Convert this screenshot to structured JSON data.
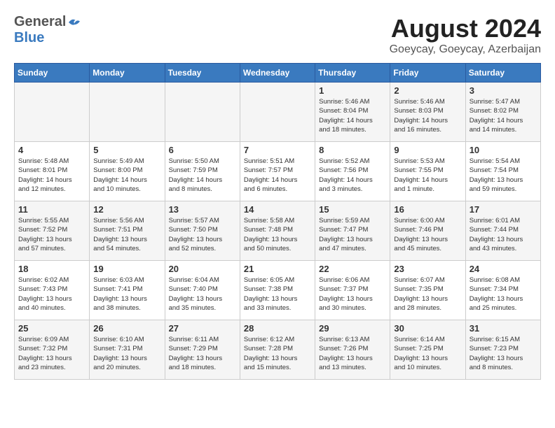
{
  "header": {
    "logo_general": "General",
    "logo_blue": "Blue",
    "month_title": "August 2024",
    "location": "Goeycay, Goeycay, Azerbaijan"
  },
  "weekdays": [
    "Sunday",
    "Monday",
    "Tuesday",
    "Wednesday",
    "Thursday",
    "Friday",
    "Saturday"
  ],
  "weeks": [
    [
      {
        "day": "",
        "content": ""
      },
      {
        "day": "",
        "content": ""
      },
      {
        "day": "",
        "content": ""
      },
      {
        "day": "",
        "content": ""
      },
      {
        "day": "1",
        "content": "Sunrise: 5:46 AM\nSunset: 8:04 PM\nDaylight: 14 hours\nand 18 minutes."
      },
      {
        "day": "2",
        "content": "Sunrise: 5:46 AM\nSunset: 8:03 PM\nDaylight: 14 hours\nand 16 minutes."
      },
      {
        "day": "3",
        "content": "Sunrise: 5:47 AM\nSunset: 8:02 PM\nDaylight: 14 hours\nand 14 minutes."
      }
    ],
    [
      {
        "day": "4",
        "content": "Sunrise: 5:48 AM\nSunset: 8:01 PM\nDaylight: 14 hours\nand 12 minutes."
      },
      {
        "day": "5",
        "content": "Sunrise: 5:49 AM\nSunset: 8:00 PM\nDaylight: 14 hours\nand 10 minutes."
      },
      {
        "day": "6",
        "content": "Sunrise: 5:50 AM\nSunset: 7:59 PM\nDaylight: 14 hours\nand 8 minutes."
      },
      {
        "day": "7",
        "content": "Sunrise: 5:51 AM\nSunset: 7:57 PM\nDaylight: 14 hours\nand 6 minutes."
      },
      {
        "day": "8",
        "content": "Sunrise: 5:52 AM\nSunset: 7:56 PM\nDaylight: 14 hours\nand 3 minutes."
      },
      {
        "day": "9",
        "content": "Sunrise: 5:53 AM\nSunset: 7:55 PM\nDaylight: 14 hours\nand 1 minute."
      },
      {
        "day": "10",
        "content": "Sunrise: 5:54 AM\nSunset: 7:54 PM\nDaylight: 13 hours\nand 59 minutes."
      }
    ],
    [
      {
        "day": "11",
        "content": "Sunrise: 5:55 AM\nSunset: 7:52 PM\nDaylight: 13 hours\nand 57 minutes."
      },
      {
        "day": "12",
        "content": "Sunrise: 5:56 AM\nSunset: 7:51 PM\nDaylight: 13 hours\nand 54 minutes."
      },
      {
        "day": "13",
        "content": "Sunrise: 5:57 AM\nSunset: 7:50 PM\nDaylight: 13 hours\nand 52 minutes."
      },
      {
        "day": "14",
        "content": "Sunrise: 5:58 AM\nSunset: 7:48 PM\nDaylight: 13 hours\nand 50 minutes."
      },
      {
        "day": "15",
        "content": "Sunrise: 5:59 AM\nSunset: 7:47 PM\nDaylight: 13 hours\nand 47 minutes."
      },
      {
        "day": "16",
        "content": "Sunrise: 6:00 AM\nSunset: 7:46 PM\nDaylight: 13 hours\nand 45 minutes."
      },
      {
        "day": "17",
        "content": "Sunrise: 6:01 AM\nSunset: 7:44 PM\nDaylight: 13 hours\nand 43 minutes."
      }
    ],
    [
      {
        "day": "18",
        "content": "Sunrise: 6:02 AM\nSunset: 7:43 PM\nDaylight: 13 hours\nand 40 minutes."
      },
      {
        "day": "19",
        "content": "Sunrise: 6:03 AM\nSunset: 7:41 PM\nDaylight: 13 hours\nand 38 minutes."
      },
      {
        "day": "20",
        "content": "Sunrise: 6:04 AM\nSunset: 7:40 PM\nDaylight: 13 hours\nand 35 minutes."
      },
      {
        "day": "21",
        "content": "Sunrise: 6:05 AM\nSunset: 7:38 PM\nDaylight: 13 hours\nand 33 minutes."
      },
      {
        "day": "22",
        "content": "Sunrise: 6:06 AM\nSunset: 7:37 PM\nDaylight: 13 hours\nand 30 minutes."
      },
      {
        "day": "23",
        "content": "Sunrise: 6:07 AM\nSunset: 7:35 PM\nDaylight: 13 hours\nand 28 minutes."
      },
      {
        "day": "24",
        "content": "Sunrise: 6:08 AM\nSunset: 7:34 PM\nDaylight: 13 hours\nand 25 minutes."
      }
    ],
    [
      {
        "day": "25",
        "content": "Sunrise: 6:09 AM\nSunset: 7:32 PM\nDaylight: 13 hours\nand 23 minutes."
      },
      {
        "day": "26",
        "content": "Sunrise: 6:10 AM\nSunset: 7:31 PM\nDaylight: 13 hours\nand 20 minutes."
      },
      {
        "day": "27",
        "content": "Sunrise: 6:11 AM\nSunset: 7:29 PM\nDaylight: 13 hours\nand 18 minutes."
      },
      {
        "day": "28",
        "content": "Sunrise: 6:12 AM\nSunset: 7:28 PM\nDaylight: 13 hours\nand 15 minutes."
      },
      {
        "day": "29",
        "content": "Sunrise: 6:13 AM\nSunset: 7:26 PM\nDaylight: 13 hours\nand 13 minutes."
      },
      {
        "day": "30",
        "content": "Sunrise: 6:14 AM\nSunset: 7:25 PM\nDaylight: 13 hours\nand 10 minutes."
      },
      {
        "day": "31",
        "content": "Sunrise: 6:15 AM\nSunset: 7:23 PM\nDaylight: 13 hours\nand 8 minutes."
      }
    ]
  ]
}
